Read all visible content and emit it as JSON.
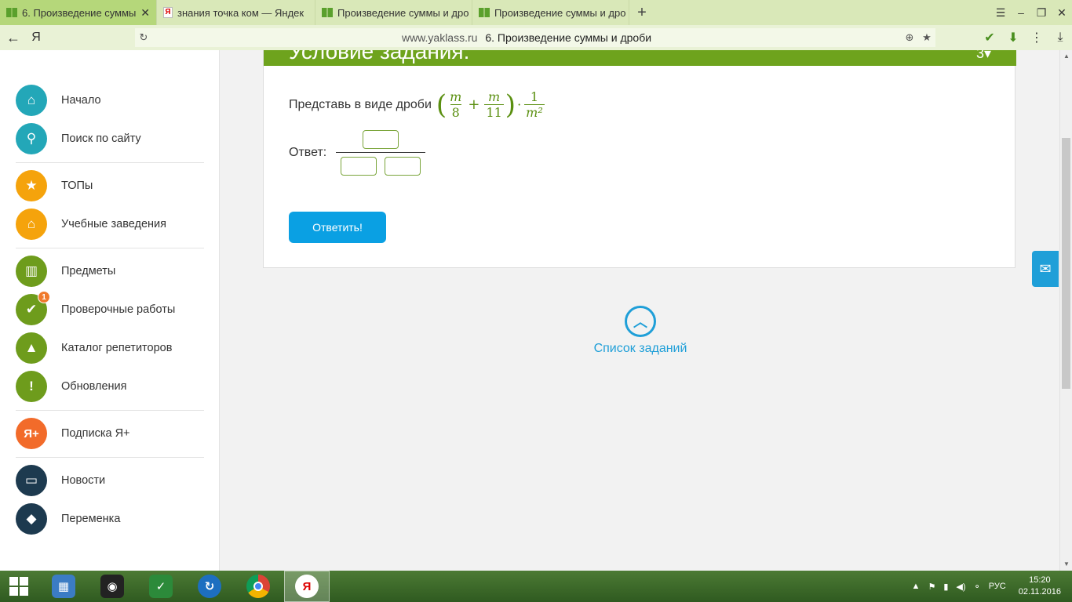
{
  "browser": {
    "tabs": [
      {
        "title": "6. Произведение суммы",
        "favicon": "yaklass-book-icon",
        "active": true
      },
      {
        "title": "знания точка ком — Яндек",
        "favicon": "yandex-icon",
        "active": false
      },
      {
        "title": "Произведение суммы и дро",
        "favicon": "yaklass-book-icon",
        "active": false
      },
      {
        "title": "Произведение суммы и дро",
        "favicon": "yaklass-book-icon",
        "active": false
      }
    ],
    "new_tab_icon": "+",
    "url_host": "www.yaklass.ru",
    "url_title": "6. Произведение суммы и дроби",
    "ya_logo": "Я"
  },
  "sidebar": {
    "items": [
      {
        "label": "Начало",
        "icon": "home-icon",
        "color": "#23a7b8"
      },
      {
        "label": "Поиск по сайту",
        "icon": "search-icon",
        "color": "#23a7b8"
      },
      {
        "label": "ТОПы",
        "icon": "star-icon",
        "color": "#f5a30c"
      },
      {
        "label": "Учебные заведения",
        "icon": "building-icon",
        "color": "#f5a30c"
      },
      {
        "label": "Предметы",
        "icon": "book-icon",
        "color": "#6e9c1c"
      },
      {
        "label": "Проверочные работы",
        "icon": "check-icon",
        "color": "#6e9c1c",
        "badge": "1"
      },
      {
        "label": "Каталог репетиторов",
        "icon": "graduation-cap-icon",
        "color": "#6e9c1c"
      },
      {
        "label": "Обновления",
        "icon": "exclamation-icon",
        "color": "#6e9c1c"
      },
      {
        "label": "Подписка Я+",
        "icon": "ya-plus-icon",
        "color": "#f26b2a",
        "glyph": "Я+"
      },
      {
        "label": "Новости",
        "icon": "chat-icon",
        "color": "#1d3a4f"
      },
      {
        "label": "Переменка",
        "icon": "bell-icon",
        "color": "#1d3a4f"
      }
    ]
  },
  "task": {
    "header_title": "Условие задания:",
    "header_points": "3",
    "prompt": "Представь в виде дроби",
    "expression": {
      "f1_num": "m",
      "f1_den": "8",
      "plus": "+",
      "f2_num": "m",
      "f2_den": "11",
      "dot": "·",
      "f3_num": "1",
      "f3_den": "m²"
    },
    "answer_label": "Ответ:",
    "submit_label": "Ответить!"
  },
  "task_list_label": "Список заданий",
  "taskbar": {
    "language": "РУС",
    "time": "15:20",
    "date": "02.11.2016",
    "yandex_glyph": "Я"
  }
}
